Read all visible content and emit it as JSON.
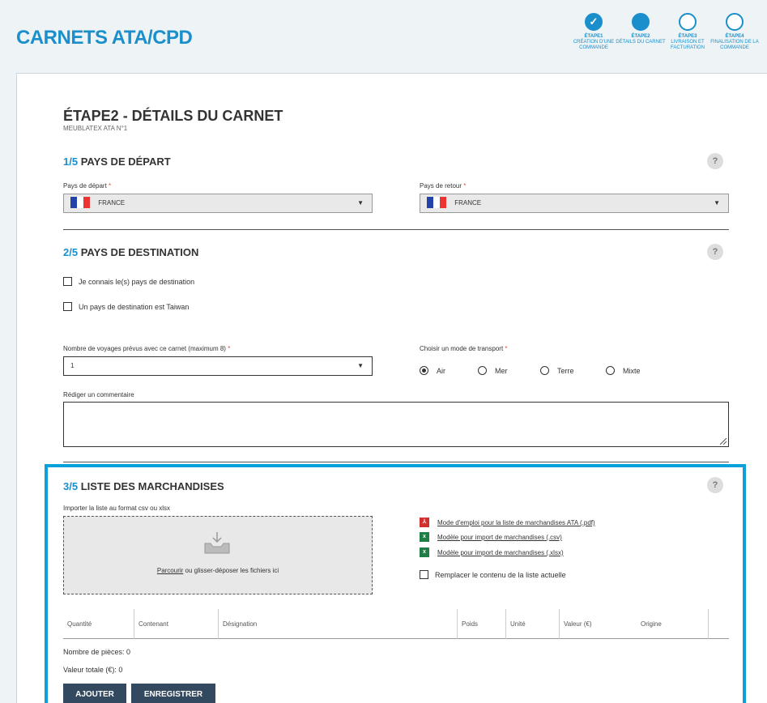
{
  "header": {
    "title": "CARNETS ATA/CPD"
  },
  "steps": [
    {
      "n": "ÉTAPE1",
      "label": "CRÉATION D'UNE COMMANDE",
      "state": "done"
    },
    {
      "n": "ÉTAPE2",
      "label": "DÉTAILS DU CARNET",
      "state": "current"
    },
    {
      "n": "ÉTAPE3",
      "label": "LIVRAISON ET FACTURATION",
      "state": "todo"
    },
    {
      "n": "ÉTAPE4",
      "label": "FINALISATION DE LA COMMANDE",
      "state": "todo"
    }
  ],
  "page": {
    "title": "ÉTAPE2 - DÉTAILS DU CARNET",
    "subtitle": "MEUBLATEX ATA N°1"
  },
  "section1": {
    "num": "1/5",
    "title": "PAYS DE DÉPART",
    "help": "?",
    "depart_label": "Pays de départ",
    "depart_value": "FRANCE",
    "retour_label": "Pays de retour",
    "retour_value": "FRANCE",
    "required_mark": "*"
  },
  "section2": {
    "num": "2/5",
    "title": "PAYS DE DESTINATION",
    "help": "?",
    "check1": "Je connais le(s) pays de destination",
    "check2": "Un pays de destination est Taiwan",
    "voyages_label": "Nombre de voyages prévus avec ce carnet (maximum 8)",
    "voyages_value": "1",
    "transport_label": "Choisir un mode de transport",
    "transport_options": [
      "Air",
      "Mer",
      "Terre",
      "Mixte"
    ],
    "transport_selected": "Air",
    "comment_label": "Rédiger un commentaire",
    "required_mark": "*"
  },
  "section3": {
    "num": "3/5",
    "title": "LISTE DES MARCHANDISES",
    "help": "?",
    "import_label": "Importer la liste au format csv ou xlsx",
    "drop_link": "Parcourir",
    "drop_text": " ou glisser-déposer les fichiers ici",
    "links": [
      {
        "text": "Mode d'emploi pour la liste de marchandises ATA (.pdf)",
        "icon": "pdf-icon",
        "color": "#d32f2f"
      },
      {
        "text": "Modèle pour import de marchandises (.csv)",
        "icon": "excel-icon",
        "color": "#1e7e45"
      },
      {
        "text": "Modèle pour import de marchandises (.xlsx)",
        "icon": "excel-icon",
        "color": "#1e7e45"
      }
    ],
    "replace_label": "Remplacer le contenu de la liste actuelle",
    "columns": [
      "Quantité",
      "Contenant",
      "Désignation",
      "Poids",
      "Unité",
      "Valeur (€)",
      "Origine"
    ],
    "pieces": "Nombre de pièces: 0",
    "total": "Valeur totale (€): 0",
    "add_btn": "AJOUTER",
    "save_btn": "ENREGISTRER"
  },
  "colors": {
    "accent": "#1a8fcb",
    "highlight": "#0aa0dc",
    "button": "#33495f"
  }
}
